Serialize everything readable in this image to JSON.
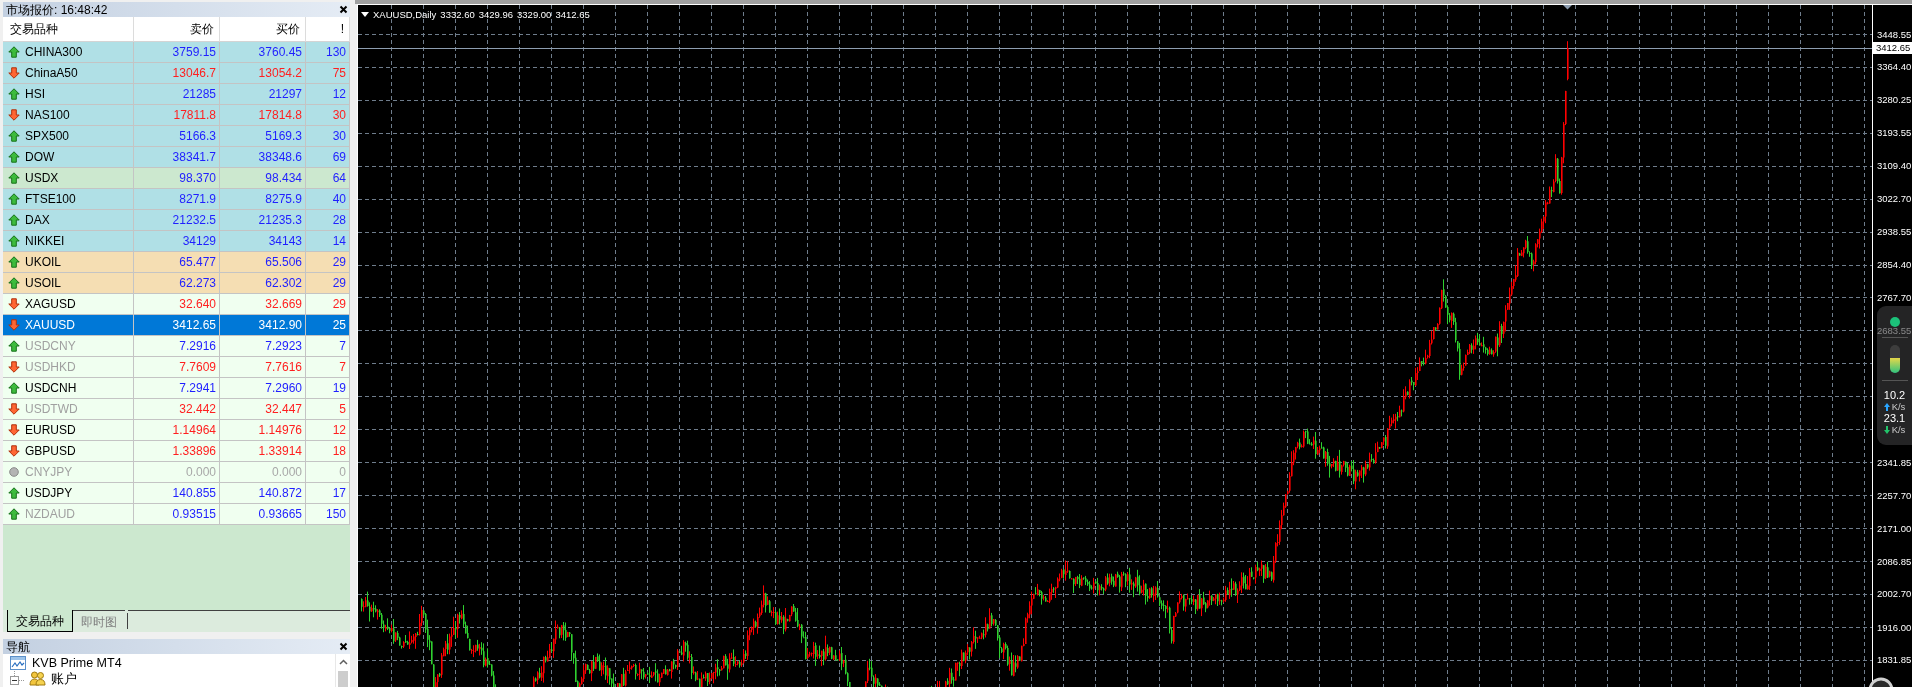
{
  "market_watch": {
    "title": "市场报价: 16:48:42",
    "columns": [
      "交易品种",
      "卖价",
      "买价",
      "!"
    ],
    "rows": [
      {
        "symbol": "CHINA300",
        "bid": "3759.15",
        "ask": "3760.45",
        "spread": "130",
        "kind": "up",
        "disabled": false,
        "selected": false,
        "color": "#b0e0e6"
      },
      {
        "symbol": "ChinaA50",
        "bid": "13046.7",
        "ask": "13054.2",
        "spread": "75",
        "kind": "down",
        "disabled": false,
        "selected": false,
        "color": "#b0e0e6"
      },
      {
        "symbol": "HSI",
        "bid": "21285",
        "ask": "21297",
        "spread": "12",
        "kind": "up",
        "disabled": false,
        "selected": false,
        "color": "#b0e0e6"
      },
      {
        "symbol": "NAS100",
        "bid": "17811.8",
        "ask": "17814.8",
        "spread": "30",
        "kind": "down",
        "disabled": false,
        "selected": false,
        "color": "#b0e0e6"
      },
      {
        "symbol": "SPX500",
        "bid": "5166.3",
        "ask": "5169.3",
        "spread": "30",
        "kind": "up",
        "disabled": false,
        "selected": false,
        "color": "#b0e0e6"
      },
      {
        "symbol": "DOW",
        "bid": "38341.7",
        "ask": "38348.6",
        "spread": "69",
        "kind": "up",
        "disabled": false,
        "selected": false,
        "color": "#b0e0e6"
      },
      {
        "symbol": "USDX",
        "bid": "98.370",
        "ask": "98.434",
        "spread": "64",
        "kind": "up",
        "disabled": false,
        "selected": false,
        "color": "#cce8cf"
      },
      {
        "symbol": "FTSE100",
        "bid": "8271.9",
        "ask": "8275.9",
        "spread": "40",
        "kind": "up",
        "disabled": false,
        "selected": false,
        "color": "#b0e0e6"
      },
      {
        "symbol": "DAX",
        "bid": "21232.5",
        "ask": "21235.3",
        "spread": "28",
        "kind": "up",
        "disabled": false,
        "selected": false,
        "color": "#b0e0e6"
      },
      {
        "symbol": "NIKKEI",
        "bid": "34129",
        "ask": "34143",
        "spread": "14",
        "kind": "up",
        "disabled": false,
        "selected": false,
        "color": "#b0e0e6"
      },
      {
        "symbol": "UKOIL",
        "bid": "65.477",
        "ask": "65.506",
        "spread": "29",
        "kind": "up",
        "disabled": false,
        "selected": false,
        "color": "#f5deb3"
      },
      {
        "symbol": "USOIL",
        "bid": "62.273",
        "ask": "62.302",
        "spread": "29",
        "kind": "up",
        "disabled": false,
        "selected": false,
        "color": "#f5deb3"
      },
      {
        "symbol": "XAGUSD",
        "bid": "32.640",
        "ask": "32.669",
        "spread": "29",
        "kind": "down",
        "disabled": false,
        "selected": false,
        "color": "#f0fff0"
      },
      {
        "symbol": "XAUUSD",
        "bid": "3412.65",
        "ask": "3412.90",
        "spread": "25",
        "kind": "down",
        "disabled": false,
        "selected": true
      },
      {
        "symbol": "USDCNY",
        "bid": "7.2916",
        "ask": "7.2923",
        "spread": "7",
        "kind": "up",
        "disabled": true,
        "selected": false,
        "color": "#f0fff0"
      },
      {
        "symbol": "USDHKD",
        "bid": "7.7609",
        "ask": "7.7616",
        "spread": "7",
        "kind": "down",
        "disabled": true,
        "selected": false,
        "color": "#f0fff0"
      },
      {
        "symbol": "USDCNH",
        "bid": "7.2941",
        "ask": "7.2960",
        "spread": "19",
        "kind": "up",
        "disabled": false,
        "selected": false,
        "color": "#f0fff0"
      },
      {
        "symbol": "USDTWD",
        "bid": "32.442",
        "ask": "32.447",
        "spread": "5",
        "kind": "down",
        "disabled": true,
        "selected": false,
        "color": "#f0fff0"
      },
      {
        "symbol": "EURUSD",
        "bid": "1.14964",
        "ask": "1.14976",
        "spread": "12",
        "kind": "down",
        "disabled": false,
        "selected": false,
        "color": "#f0fff0"
      },
      {
        "symbol": "GBPUSD",
        "bid": "1.33896",
        "ask": "1.33914",
        "spread": "18",
        "kind": "down",
        "disabled": false,
        "selected": false,
        "color": "#f0fff0"
      },
      {
        "symbol": "CNYJPY",
        "bid": "0.000",
        "ask": "0.000",
        "spread": "0",
        "kind": "flat",
        "disabled": true,
        "selected": false,
        "color": "#f0fff0"
      },
      {
        "symbol": "USDJPY",
        "bid": "140.855",
        "ask": "140.872",
        "spread": "17",
        "kind": "up",
        "disabled": false,
        "selected": false,
        "color": "#f0fff0"
      },
      {
        "symbol": "NZDAUD",
        "bid": "0.93515",
        "ask": "0.93665",
        "spread": "150",
        "kind": "up",
        "disabled": true,
        "selected": false,
        "color": "#f0fff0"
      }
    ],
    "tabs": [
      {
        "label": "交易品种",
        "selected": true
      },
      {
        "label": "即时图",
        "selected": false
      }
    ]
  },
  "navigator": {
    "title": "导航",
    "items": [
      {
        "label": "KVB Prime MT4",
        "kind": "terminal",
        "children": [
          {
            "label": "账户",
            "kind": "accounts",
            "expanded": true
          }
        ]
      }
    ]
  },
  "chart": {
    "symbol": "XAUUSD,Daily",
    "ohlc": [
      "3332.60",
      "3429.96",
      "3329.00",
      "3412.65"
    ],
    "price_axis": [
      "3448.55",
      "3364.40",
      "3280.25",
      "3193.55",
      "3109.40",
      "3022.70",
      "2938.55",
      "2854.40",
      "2767.70",
      "2683.55",
      "2341.85",
      "2257.70",
      "2171.00",
      "2086.85",
      "2002.70",
      "1916.00",
      "1831.85"
    ],
    "current_price": "3412.65"
  },
  "speed_widget": {
    "level": 0.55,
    "upload_speed": "10.2",
    "upload_unit": "K/s",
    "download_speed": "23.1",
    "download_unit": "K/s"
  }
}
